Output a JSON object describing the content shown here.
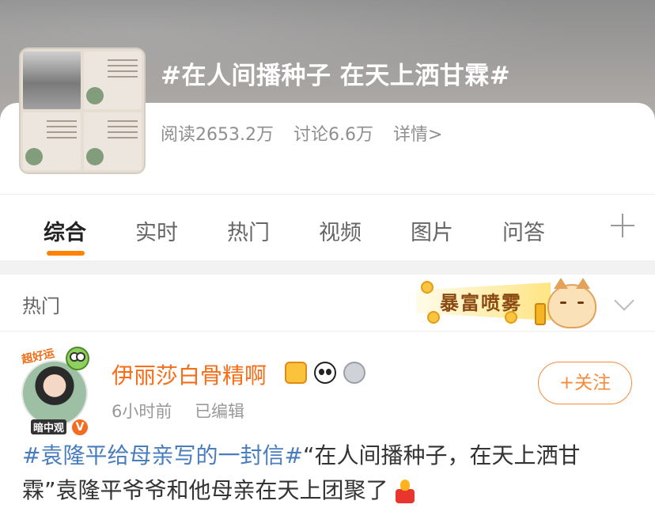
{
  "topic": {
    "title": "#在人间播种子 在天上洒甘霖#",
    "read_count": "阅读2653.2万",
    "discuss_count": "讨论6.6万",
    "details_link": "详情>"
  },
  "tabs": [
    {
      "label": "综合",
      "active": true
    },
    {
      "label": "实时",
      "active": false
    },
    {
      "label": "热门",
      "active": false
    },
    {
      "label": "视频",
      "active": false
    },
    {
      "label": "图片",
      "active": false
    },
    {
      "label": "问答",
      "active": false
    }
  ],
  "section": {
    "label": "热门",
    "promo_text": "暴富喷雾"
  },
  "post": {
    "avatar_sticker": "超好运",
    "avatar_tag": "暗中观",
    "verified_mark": "V",
    "username": "伊丽莎白骨精啊",
    "time": "6小时前",
    "edited": "已编辑",
    "follow_label": "+关注",
    "hashtag": "#袁隆平给母亲写的一封信#",
    "body": "“在人间播种子，在天上洒甘霖”袁隆平爷爷和他母亲在天上团聚了"
  },
  "colors": {
    "accent_orange": "#ff8200",
    "username_orange": "#f86e18",
    "hashtag_blue": "#4a7dbd"
  }
}
